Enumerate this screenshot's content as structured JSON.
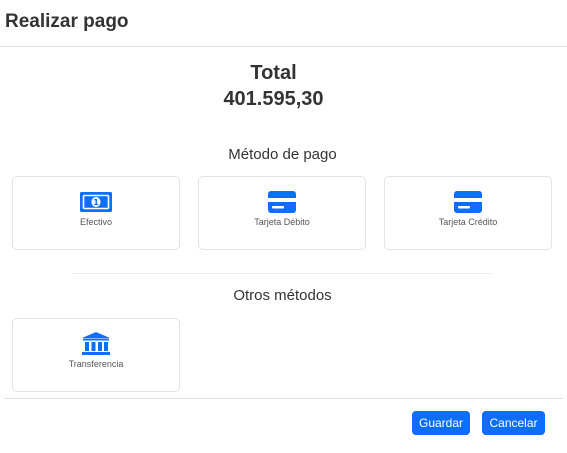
{
  "modal": {
    "title": "Realizar pago"
  },
  "total": {
    "label": "Total",
    "amount": "401.595,30"
  },
  "payment_methods": {
    "title": "Método de pago",
    "items": [
      {
        "label": "Efectivo",
        "icon": "cash-icon"
      },
      {
        "label": "Tarjeta Débito",
        "icon": "credit-card-icon"
      },
      {
        "label": "Tarjeta Crédito",
        "icon": "credit-card-icon"
      }
    ]
  },
  "other_methods": {
    "title": "Otros métodos",
    "items": [
      {
        "label": "Transferencia",
        "icon": "bank-icon"
      }
    ]
  },
  "footer": {
    "save_label": "Guardar",
    "cancel_label": "Cancelar"
  },
  "colors": {
    "accent": "#0d6efd",
    "text": "#333333",
    "border": "#e3e3e3"
  }
}
